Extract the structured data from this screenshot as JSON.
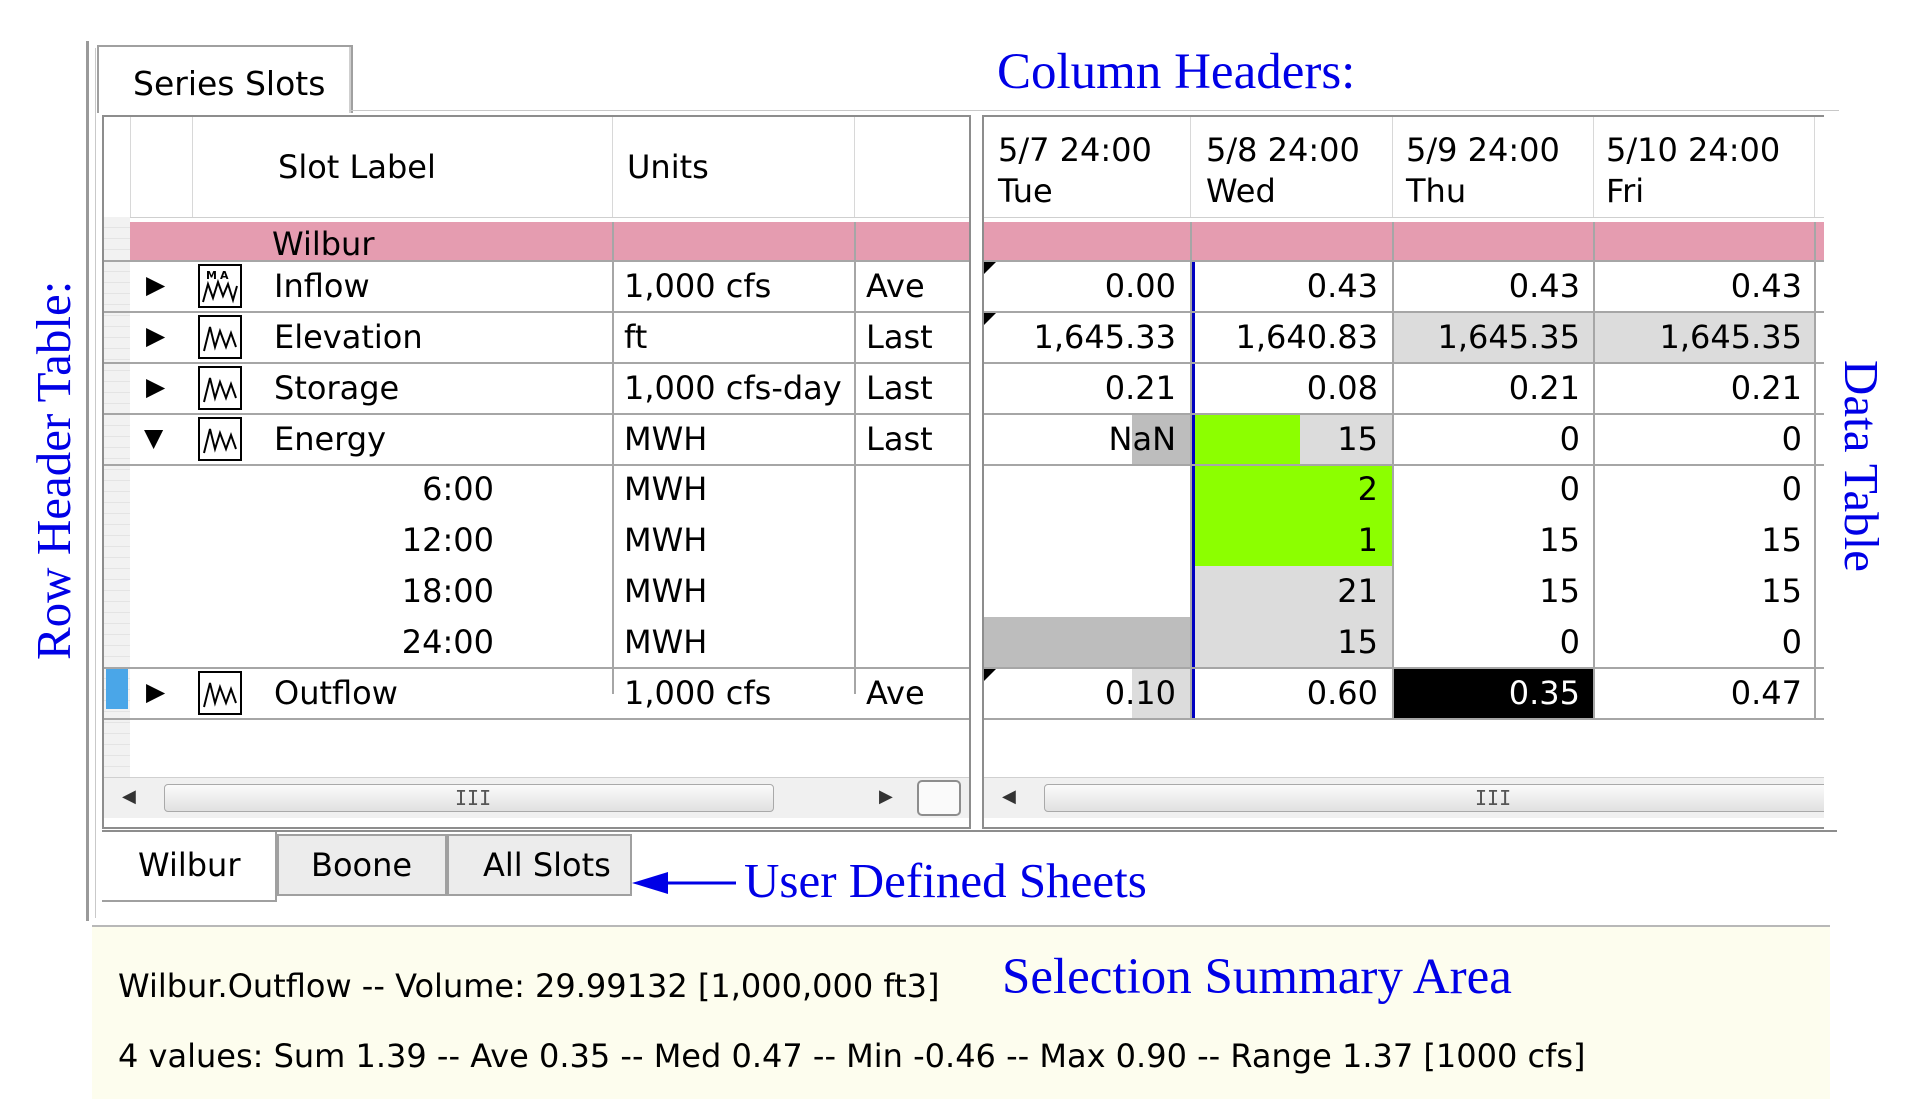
{
  "top_tab": {
    "label": "Series Slots"
  },
  "annotations": {
    "column_headers": "Column Headers:",
    "row_header_table": "Row Header Table:",
    "data_table": "Data Table",
    "user_defined_sheets": "User Defined Sheets",
    "selection_summary_area": "Selection Summary Area"
  },
  "row_header": {
    "col_slot_label": "Slot Label",
    "col_units": "Units",
    "group": "Wilbur",
    "rows": [
      {
        "label": "Inflow",
        "units": "1,000 cfs",
        "agg": "Ave"
      },
      {
        "label": "Elevation",
        "units": "ft",
        "agg": "Last"
      },
      {
        "label": "Storage",
        "units": "1,000 cfs-day",
        "agg": "Last"
      },
      {
        "label": "Energy",
        "units": "MWH",
        "agg": "Last"
      },
      {
        "label": "6:00",
        "units": "MWH",
        "agg": ""
      },
      {
        "label": "12:00",
        "units": "MWH",
        "agg": ""
      },
      {
        "label": "18:00",
        "units": "MWH",
        "agg": ""
      },
      {
        "label": "24:00",
        "units": "MWH",
        "agg": ""
      },
      {
        "label": "Outflow",
        "units": "1,000 cfs",
        "agg": "Ave"
      }
    ],
    "scroll_grip": "III"
  },
  "data_table": {
    "columns": [
      {
        "date": "5/7 24:00",
        "day": "Tue"
      },
      {
        "date": "5/8 24:00",
        "day": "Wed"
      },
      {
        "date": "5/9 24:00",
        "day": "Thu"
      },
      {
        "date": "5/10 24:00",
        "day": "Fri"
      }
    ],
    "rows": [
      [
        "0.00",
        "0.43",
        "0.43",
        "0.43"
      ],
      [
        "1,645.33",
        "1,640.83",
        "1,645.35",
        "1,645.35"
      ],
      [
        "0.21",
        "0.08",
        "0.21",
        "0.21"
      ],
      [
        "NaN",
        "15",
        "0",
        "0"
      ],
      [
        "",
        "2",
        "0",
        "0"
      ],
      [
        "",
        "1",
        "15",
        "15"
      ],
      [
        "",
        "21",
        "15",
        "15"
      ],
      [
        "",
        "15",
        "0",
        "0"
      ],
      [
        "0.10",
        "0.60",
        "0.35",
        "0.47"
      ]
    ],
    "scroll_grip": "III",
    "colors": {
      "group_band": "#e59cb0",
      "highlight_green": "#8cff00",
      "gray_cell": "#dcdcdc",
      "dark_gray": "#bdbdbd",
      "selected_black": "#000000",
      "blue_divider": "#0000c0"
    }
  },
  "sheets": [
    {
      "label": "Wilbur",
      "active": true
    },
    {
      "label": "Boone",
      "active": false
    },
    {
      "label": "All Slots",
      "active": false
    }
  ],
  "summary": {
    "line1": "Wilbur.Outflow -- Volume: 29.99132 [1,000,000 ft3]",
    "line2": "4 values:  Sum 1.39 -- Ave 0.35 -- Med 0.47 -- Min -0.46 -- Max 0.90 -- Range 1.37 [1000 cfs]"
  }
}
